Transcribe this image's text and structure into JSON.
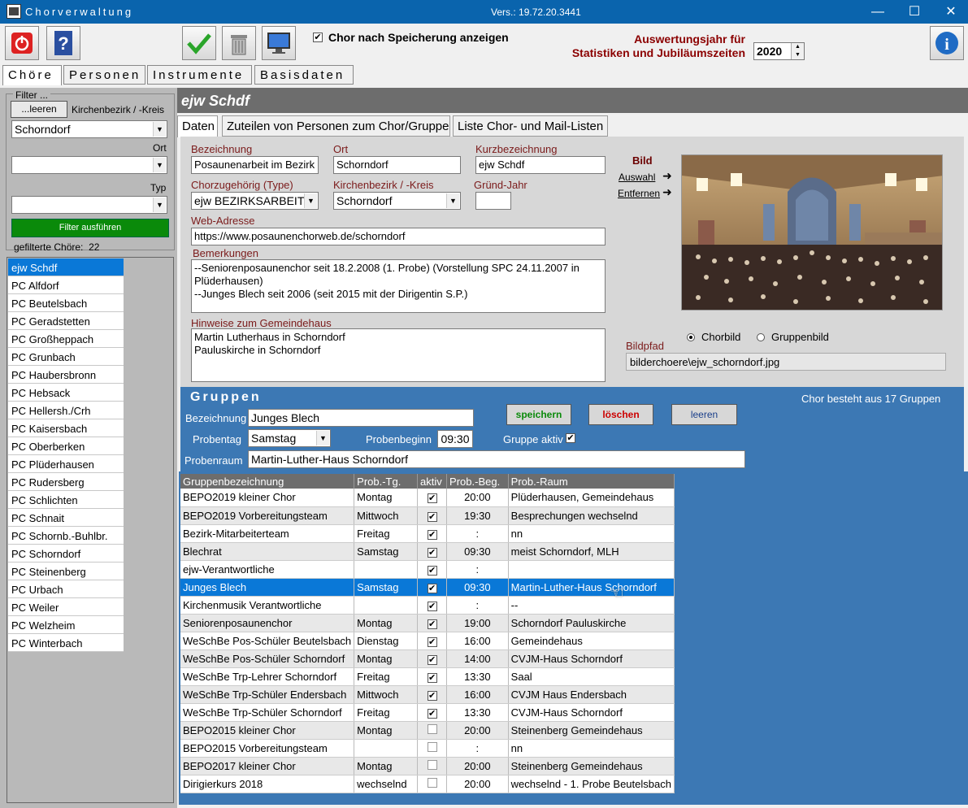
{
  "titlebar": {
    "app_name": "Chorverwaltung",
    "version": "Vers.: 19.72.20.3441"
  },
  "toolbar": {
    "show_after_save_label": "Chor nach Speicherung anzeigen",
    "year_label_line1": "Auswertungsjahr für",
    "year_label_line2": "Statistiken und Jubiläumszeiten",
    "year_value": "2020"
  },
  "main_tabs": [
    "Chöre",
    "Personen",
    "Instrumente",
    "Basisdaten"
  ],
  "filter": {
    "title": "Filter ...",
    "clear_label": "...leeren",
    "district_label": "Kirchenbezirk / -Kreis",
    "district_value": "Schorndorf",
    "ort_label": "Ort",
    "ort_value": "",
    "typ_label": "Typ",
    "typ_value": "",
    "run_label": "Filter ausführen",
    "count_label": "gefilterte Chöre:",
    "count_value": "22"
  },
  "choirs": [
    "ejw Schdf",
    "PC Alfdorf",
    "PC Beutelsbach",
    "PC Geradstetten",
    "PC Großheppach",
    "PC Grunbach",
    "PC Haubersbronn",
    "PC Hebsack",
    "PC Hellersh./Crh",
    "PC Kaisersbach",
    "PC Oberberken",
    "PC Plüderhausen",
    "PC Rudersberg",
    "PC Schlichten",
    "PC Schnait",
    "PC Schornb.-Buhlbr. e.V.",
    "PC Schorndorf",
    "PC Steinenberg",
    "PC Urbach",
    "PC Weiler",
    "PC Welzheim",
    "PC Winterbach"
  ],
  "selected_choir": "ejw Schdf",
  "sub_tabs": [
    "Daten",
    "Zuteilen von Personen zum Chor/Gruppe",
    "Liste Chor- und Mail-Listen"
  ],
  "form": {
    "bezeichnung_label": "Bezeichnung",
    "bezeichnung": "Posaunenarbeit im Bezirk",
    "ort_label": "Ort",
    "ort": "Schorndorf",
    "kurz_label": "Kurzbezeichnung",
    "kurz": "ejw Schdf",
    "type_label": "Chorzugehörig (Type)",
    "type": "ejw BEZIRKSARBEIT",
    "kreis_label": "Kirchenbezirk / -Kreis",
    "kreis": "Schorndorf",
    "jahr_label": "Gründ-Jahr",
    "jahr": "",
    "web_label": "Web-Adresse",
    "web": "https://www.posaunenchorweb.de/schorndorf",
    "bemerk_label": "Bemerkungen",
    "bemerk_line1": "--Seniorenposaunenchor seit 18.2.2008 (1. Probe) (Vorstellung SPC 24.11.2007 in",
    "bemerk_line2": "Plüderhausen)",
    "bemerk_line3": "--Junges Blech seit 2006 (seit 2015 mit der Dirigentin S.P.)",
    "hinweis_label": "Hinweise zum Gemeindehaus",
    "hinweis_line1": "Martin Lutherhaus in Schorndorf",
    "hinweis_line2": "Pauluskirche in Schorndorf",
    "bild_label": "Bild",
    "auswahl": "Auswahl",
    "entfernen": "Entfernen",
    "chorbild": "Chorbild",
    "gruppenbild": "Gruppenbild",
    "bildpfad_label": "Bildpfad",
    "bildpfad": "bilderchoere\\ejw_schorndorf.jpg"
  },
  "groups": {
    "title": "Gruppen",
    "count_text": "Chor besteht aus 17 Gruppen",
    "bez_label": "Bezeichnung",
    "bez": "Junges Blech",
    "tag_label": "Probentag",
    "tag": "Samstag",
    "beginn_label": "Probenbeginn",
    "beginn": "09:30",
    "aktiv_label": "Gruppe aktiv",
    "raum_label": "Probenraum",
    "raum": "Martin-Luther-Haus Schorndorf",
    "save": "speichern",
    "delete": "löschen",
    "clear": "leeren",
    "headers": [
      "Gruppenbezeichnung",
      "Prob.-Tg.",
      "aktiv",
      "Prob.-Beg.",
      "Prob.-Raum"
    ],
    "rows": [
      {
        "name": "BEPO2019 kleiner Chor",
        "tag": "Montag",
        "aktiv": true,
        "beg": "20:00",
        "raum": "Plüderhausen, Gemeindehaus"
      },
      {
        "name": "BEPO2019 Vorbereitungsteam",
        "tag": "Mittwoch",
        "aktiv": true,
        "beg": "19:30",
        "raum": "Besprechungen wechselnd"
      },
      {
        "name": "Bezirk-Mitarbeiterteam",
        "tag": "Freitag",
        "aktiv": true,
        "beg": ":",
        "raum": "nn"
      },
      {
        "name": "Blechrat",
        "tag": "Samstag",
        "aktiv": true,
        "beg": "09:30",
        "raum": "meist Schorndorf, MLH"
      },
      {
        "name": "ejw-Verantwortliche",
        "tag": "",
        "aktiv": true,
        "beg": ":",
        "raum": ""
      },
      {
        "name": "Junges Blech",
        "tag": "Samstag",
        "aktiv": true,
        "beg": "09:30",
        "raum": "Martin-Luther-Haus Schorndorf"
      },
      {
        "name": "Kirchenmusik Verantwortliche",
        "tag": "",
        "aktiv": true,
        "beg": ":",
        "raum": "--"
      },
      {
        "name": "Seniorenposaunenchor",
        "tag": "Montag",
        "aktiv": true,
        "beg": "19:00",
        "raum": "Schorndorf Pauluskirche"
      },
      {
        "name": "WeSchBe Pos-Schüler  Beutelsbach",
        "tag": "Dienstag",
        "aktiv": true,
        "beg": "16:00",
        "raum": "Gemeindehaus"
      },
      {
        "name": "WeSchBe Pos-Schüler  Schorndorf",
        "tag": "Montag",
        "aktiv": true,
        "beg": "14:00",
        "raum": "CVJM-Haus Schorndorf"
      },
      {
        "name": "WeSchBe Trp-Lehrer  Schorndorf",
        "tag": "Freitag",
        "aktiv": true,
        "beg": "13:30",
        "raum": "Saal"
      },
      {
        "name": "WeSchBe Trp-Schüler  Endersbach",
        "tag": "Mittwoch",
        "aktiv": true,
        "beg": "16:00",
        "raum": "CVJM Haus Endersbach"
      },
      {
        "name": "WeSchBe Trp-Schüler  Schorndorf",
        "tag": "Freitag",
        "aktiv": true,
        "beg": "13:30",
        "raum": "CVJM-Haus Schorndorf"
      },
      {
        "name": "BEPO2015 kleiner Chor",
        "tag": "Montag",
        "aktiv": false,
        "beg": "20:00",
        "raum": "Steinenberg Gemeindehaus"
      },
      {
        "name": "BEPO2015 Vorbereitungsteam",
        "tag": "",
        "aktiv": false,
        "beg": ":",
        "raum": "nn"
      },
      {
        "name": "BEPO2017 kleiner Chor",
        "tag": "Montag",
        "aktiv": false,
        "beg": "20:00",
        "raum": "Steinenberg Gemeindehaus"
      },
      {
        "name": "Dirigierkurs 2018",
        "tag": "wechselnd",
        "aktiv": false,
        "beg": "20:00",
        "raum": "wechselnd - 1. Probe Beutelsbach"
      }
    ],
    "selected_row": 5
  }
}
